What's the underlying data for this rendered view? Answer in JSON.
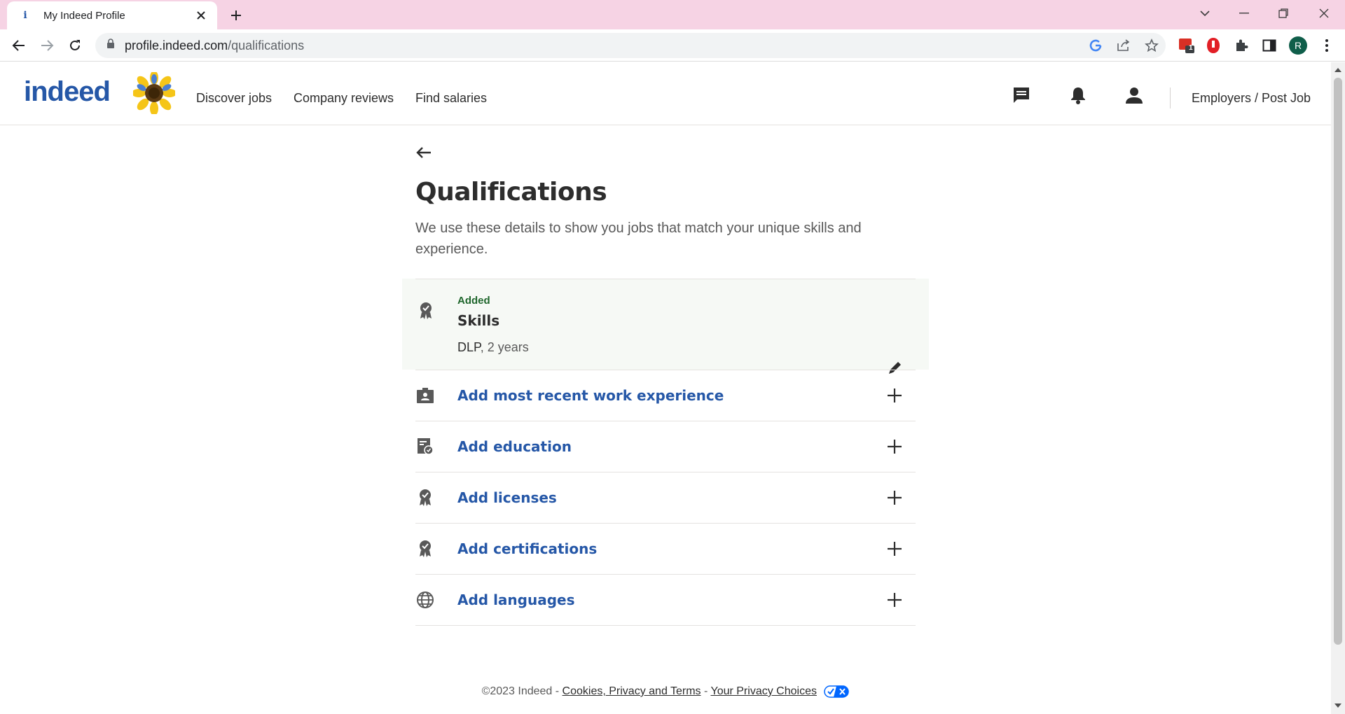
{
  "browser": {
    "tab_title": "My Indeed Profile",
    "url_domain": "profile.indeed.com",
    "url_path": "/qualifications",
    "profile_initial": "R",
    "extension_badge": "1"
  },
  "header": {
    "logo_text": "indeed",
    "nav": [
      "Discover jobs",
      "Company reviews",
      "Find salaries"
    ],
    "employers_link": "Employers / Post Job"
  },
  "main": {
    "title": "Qualifications",
    "subtitle": "We use these details to show you jobs that match your unique skills and experience.",
    "skills_card": {
      "status": "Added",
      "title": "Skills",
      "skill_name": "DLP",
      "skill_duration": ", 2 years"
    },
    "rows": [
      {
        "label": "Add most recent work experience",
        "icon": "work-badge-icon"
      },
      {
        "label": "Add education",
        "icon": "education-icon"
      },
      {
        "label": "Add licenses",
        "icon": "license-award-icon"
      },
      {
        "label": "Add certifications",
        "icon": "certification-award-icon"
      },
      {
        "label": "Add languages",
        "icon": "globe-icon"
      }
    ]
  },
  "footer": {
    "copyright": "©2023 Indeed - ",
    "cookies_link": "Cookies, Privacy and Terms",
    "separator": " - ",
    "privacy_link": "Your Privacy Choices"
  },
  "colors": {
    "link_blue": "#2557a7",
    "added_green": "#1f662c",
    "tabstrip_pink": "#f6d3e4"
  }
}
